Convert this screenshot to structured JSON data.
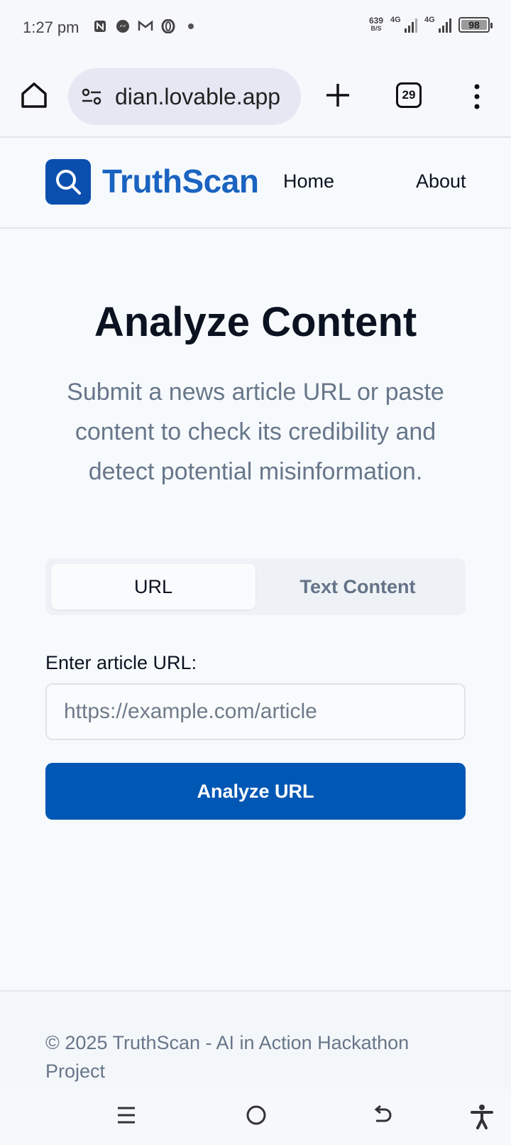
{
  "status_bar": {
    "time": "1:27 pm",
    "net_speed": "639",
    "net_unit": "B/S",
    "signal1_label": "4G",
    "signal2_label": "4G",
    "battery": "98"
  },
  "browser": {
    "url": "dian.lovable.app",
    "tab_count": "29"
  },
  "site": {
    "brand": "TruthScan",
    "nav": {
      "home": "Home",
      "about": "About"
    }
  },
  "main": {
    "title": "Analyze Content",
    "subtitle": "Submit a news article URL or paste content to check its credibility and detect potential misinformation.",
    "tabs": {
      "url": "URL",
      "text": "Text Content"
    },
    "field_label": "Enter article URL:",
    "input_placeholder": "https://example.com/article",
    "input_value": "",
    "analyze_button": "Analyze URL"
  },
  "footer": {
    "text": "© 2025 TruthScan - AI in Action Hackathon Project"
  },
  "colors": {
    "brand_blue": "#1a63c0",
    "button_blue": "#0157b4",
    "logo_bg": "#0b4fae",
    "muted_text": "#677689"
  },
  "icons": {
    "home": "home-icon",
    "site_settings": "tune-icon",
    "new_tab": "plus-icon",
    "tabs": "tab-switcher-icon",
    "menu": "more-vert-icon",
    "logo": "search-icon",
    "nav_menu": "recent-apps-icon",
    "nav_home": "home-circle-icon",
    "nav_back": "back-icon",
    "accessibility": "accessibility-icon"
  }
}
